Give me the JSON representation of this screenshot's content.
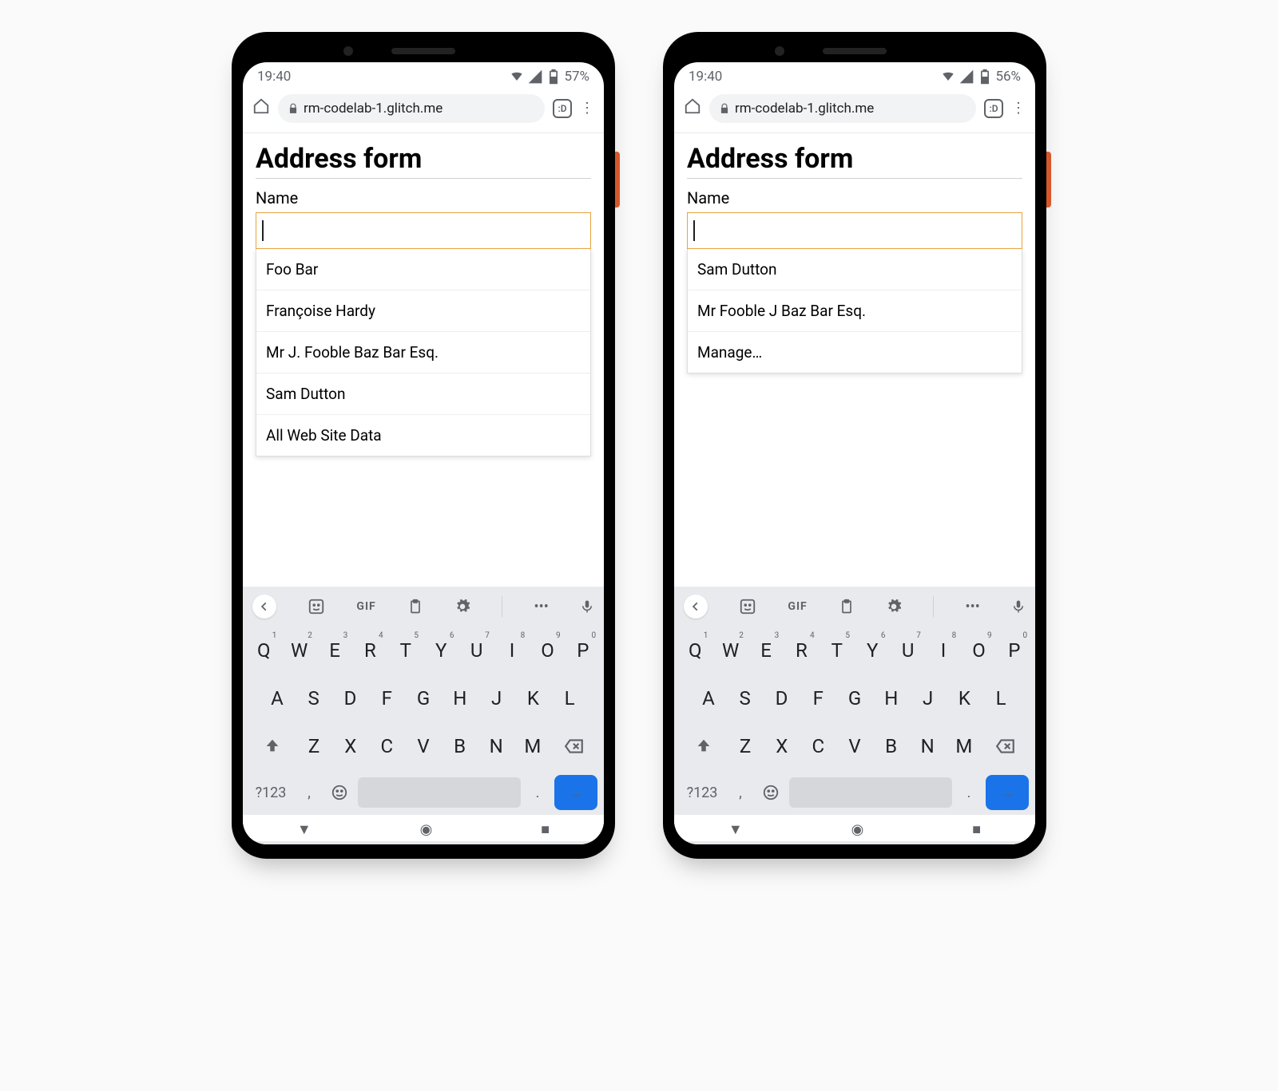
{
  "phones": [
    {
      "status": {
        "time": "19:40",
        "battery": "57%"
      },
      "browser": {
        "url": "rm-codelab-1.glitch.me",
        "tabs": ":D"
      },
      "page": {
        "title": "Address form",
        "name_label": "Name",
        "name_value": "",
        "suggestions": [
          "Foo Bar",
          "Françoise Hardy",
          "Mr J. Fooble Baz Bar Esq.",
          "Sam Dutton",
          "All Web Site Data"
        ]
      }
    },
    {
      "status": {
        "time": "19:40",
        "battery": "56%"
      },
      "browser": {
        "url": "rm-codelab-1.glitch.me",
        "tabs": ":D"
      },
      "page": {
        "title": "Address form",
        "name_label": "Name",
        "name_value": "",
        "suggestions": [
          "Sam Dutton",
          "Mr Fooble J Baz Bar Esq.",
          "Manage…"
        ]
      }
    }
  ],
  "keyboard": {
    "toolbar": {
      "gif": "GIF"
    },
    "row1": [
      {
        "k": "Q",
        "n": "1"
      },
      {
        "k": "W",
        "n": "2"
      },
      {
        "k": "E",
        "n": "3"
      },
      {
        "k": "R",
        "n": "4"
      },
      {
        "k": "T",
        "n": "5"
      },
      {
        "k": "Y",
        "n": "6"
      },
      {
        "k": "U",
        "n": "7"
      },
      {
        "k": "I",
        "n": "8"
      },
      {
        "k": "O",
        "n": "9"
      },
      {
        "k": "P",
        "n": "0"
      }
    ],
    "row2": [
      "A",
      "S",
      "D",
      "F",
      "G",
      "H",
      "J",
      "K",
      "L"
    ],
    "row3": [
      "Z",
      "X",
      "C",
      "V",
      "B",
      "N",
      "M"
    ],
    "bottom": {
      "nums": "?123",
      "comma": ",",
      "period": "."
    }
  }
}
